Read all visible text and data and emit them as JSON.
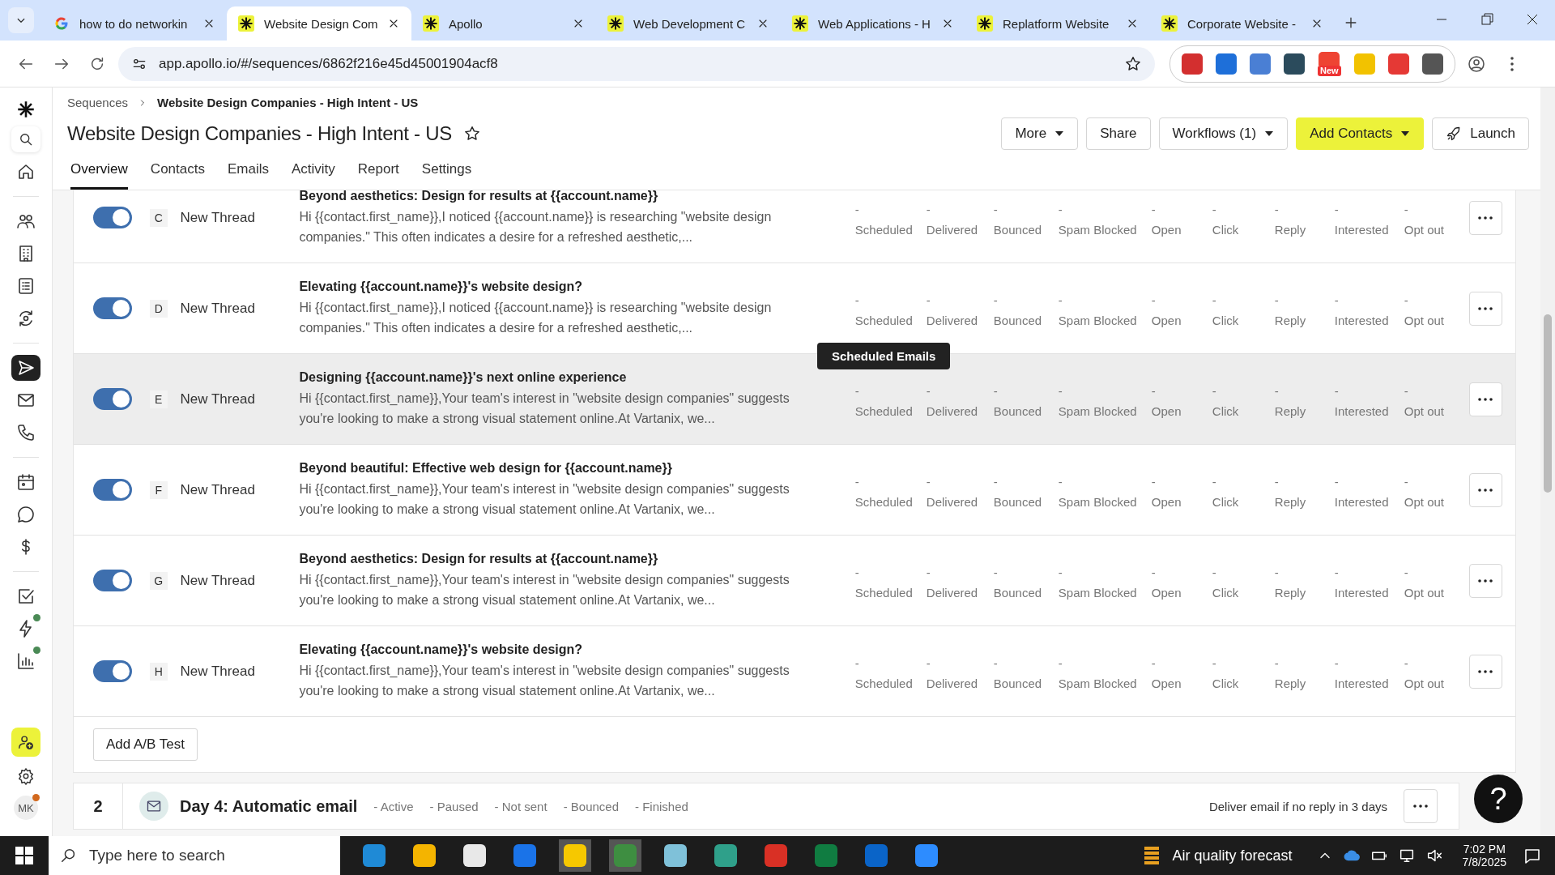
{
  "browser": {
    "tabs": [
      {
        "title": "how to do networkin",
        "kind": "google",
        "selected": false
      },
      {
        "title": "Website Design Com",
        "kind": "apollo",
        "selected": true
      },
      {
        "title": "Apollo",
        "kind": "apollo",
        "selected": false
      },
      {
        "title": "Web Development C",
        "kind": "apollo",
        "selected": false
      },
      {
        "title": "Web Applications - H",
        "kind": "apollo",
        "selected": false
      },
      {
        "title": "Replatform Website",
        "kind": "apollo",
        "selected": false
      },
      {
        "title": "Corporate Website -",
        "kind": "apollo",
        "selected": false
      }
    ],
    "url": "app.apollo.io/#/sequences/6862f216e45d45001904acf8",
    "extension_badge": "New"
  },
  "sidebar": {
    "items": [
      {
        "selected": false,
        "badge": false
      },
      {
        "selected": false,
        "badge": false
      },
      {
        "selected": false,
        "badge": false
      },
      {
        "selected": false,
        "badge": false
      },
      {
        "selected": false,
        "badge": false
      },
      {
        "selected": true,
        "badge": false
      },
      {
        "selected": false,
        "badge": false
      },
      {
        "selected": false,
        "badge": false
      },
      {
        "selected": false,
        "badge": false
      },
      {
        "selected": false,
        "badge": false
      },
      {
        "selected": false,
        "badge": false
      },
      {
        "selected": false,
        "badge": false
      },
      {
        "selected": false,
        "badge": true
      },
      {
        "selected": false,
        "badge": true
      }
    ],
    "avatar": "MK"
  },
  "header": {
    "breadcrumb": [
      "Sequences",
      "Website Design Companies - High Intent - US"
    ],
    "title": "Website Design Companies - High Intent - US",
    "buttons": [
      {
        "label": "More",
        "kind": "dropdown"
      },
      {
        "label": "Share",
        "kind": "plain"
      },
      {
        "label": "Workflows (1)",
        "kind": "dropdown"
      },
      {
        "label": "Add Contacts",
        "kind": "primary"
      },
      {
        "label": "Launch",
        "kind": "launch"
      }
    ],
    "tabs": [
      {
        "label": "Overview",
        "selected": true
      },
      {
        "label": "Contacts",
        "selected": false
      },
      {
        "label": "Emails",
        "selected": false
      },
      {
        "label": "Activity",
        "selected": false
      },
      {
        "label": "Report",
        "selected": false
      },
      {
        "label": "Settings",
        "selected": false
      }
    ]
  },
  "steps": [
    {
      "on": true,
      "letter": "C",
      "thread": "New Thread",
      "highlighted": false,
      "subject": "Beyond aesthetics: Design for results at {{account.name}}",
      "preview": "Hi {{contact.first_name}},I noticed {{account.name}} is researching \"website design companies.\" This often indicates a desire for a refreshed aesthetic,...",
      "stats": [
        {
          "value": "-",
          "label": "Scheduled"
        },
        {
          "value": "-",
          "label": "Delivered"
        },
        {
          "value": "-",
          "label": "Bounced"
        },
        {
          "value": "-",
          "label": "Spam Blocked"
        },
        {
          "value": "-",
          "label": "Open"
        },
        {
          "value": "-",
          "label": "Click"
        },
        {
          "value": "-",
          "label": "Reply"
        },
        {
          "value": "-",
          "label": "Interested"
        },
        {
          "value": "-",
          "label": "Opt out"
        }
      ]
    },
    {
      "on": true,
      "letter": "D",
      "thread": "New Thread",
      "highlighted": false,
      "subject": "Elevating {{account.name}}'s website design?",
      "preview": "Hi {{contact.first_name}},I noticed {{account.name}} is researching \"website design companies.\" This often indicates a desire for a refreshed aesthetic,...",
      "stats": [
        {
          "value": "-",
          "label": "Scheduled"
        },
        {
          "value": "-",
          "label": "Delivered"
        },
        {
          "value": "-",
          "label": "Bounced"
        },
        {
          "value": "-",
          "label": "Spam Blocked"
        },
        {
          "value": "-",
          "label": "Open"
        },
        {
          "value": "-",
          "label": "Click"
        },
        {
          "value": "-",
          "label": "Reply"
        },
        {
          "value": "-",
          "label": "Interested"
        },
        {
          "value": "-",
          "label": "Opt out"
        }
      ]
    },
    {
      "on": true,
      "letter": "E",
      "thread": "New Thread",
      "highlighted": true,
      "subject": "Designing {{account.name}}'s next online experience",
      "preview": "Hi {{contact.first_name}},Your team's interest in \"website design companies\" suggests you're looking to make a strong visual statement online.At Vartanix, we...",
      "stats": [
        {
          "value": "-",
          "label": "Scheduled"
        },
        {
          "value": "-",
          "label": "Delivered"
        },
        {
          "value": "-",
          "label": "Bounced"
        },
        {
          "value": "-",
          "label": "Spam Blocked"
        },
        {
          "value": "-",
          "label": "Open"
        },
        {
          "value": "-",
          "label": "Click"
        },
        {
          "value": "-",
          "label": "Reply"
        },
        {
          "value": "-",
          "label": "Interested"
        },
        {
          "value": "-",
          "label": "Opt out"
        }
      ]
    },
    {
      "on": true,
      "letter": "F",
      "thread": "New Thread",
      "highlighted": false,
      "subject": "Beyond beautiful: Effective web design for {{account.name}}",
      "preview": "Hi {{contact.first_name}},Your team's interest in \"website design companies\" suggests you're looking to make a strong visual statement online.At Vartanix, we...",
      "stats": [
        {
          "value": "-",
          "label": "Scheduled"
        },
        {
          "value": "-",
          "label": "Delivered"
        },
        {
          "value": "-",
          "label": "Bounced"
        },
        {
          "value": "-",
          "label": "Spam Blocked"
        },
        {
          "value": "-",
          "label": "Open"
        },
        {
          "value": "-",
          "label": "Click"
        },
        {
          "value": "-",
          "label": "Reply"
        },
        {
          "value": "-",
          "label": "Interested"
        },
        {
          "value": "-",
          "label": "Opt out"
        }
      ]
    },
    {
      "on": true,
      "letter": "G",
      "thread": "New Thread",
      "highlighted": false,
      "subject": "Beyond aesthetics: Design for results at {{account.name}}",
      "preview": "Hi {{contact.first_name}},Your team's interest in \"website design companies\" suggests you're looking to make a strong visual statement online.At Vartanix, we...",
      "stats": [
        {
          "value": "-",
          "label": "Scheduled"
        },
        {
          "value": "-",
          "label": "Delivered"
        },
        {
          "value": "-",
          "label": "Bounced"
        },
        {
          "value": "-",
          "label": "Spam Blocked"
        },
        {
          "value": "-",
          "label": "Open"
        },
        {
          "value": "-",
          "label": "Click"
        },
        {
          "value": "-",
          "label": "Reply"
        },
        {
          "value": "-",
          "label": "Interested"
        },
        {
          "value": "-",
          "label": "Opt out"
        }
      ]
    },
    {
      "on": true,
      "letter": "H",
      "thread": "New Thread",
      "highlighted": false,
      "subject": "Elevating {{account.name}}'s website design?",
      "preview": "Hi {{contact.first_name}},Your team's interest in \"website design companies\" suggests you're looking to make a strong visual statement online.At Vartanix, we...",
      "stats": [
        {
          "value": "-",
          "label": "Scheduled"
        },
        {
          "value": "-",
          "label": "Delivered"
        },
        {
          "value": "-",
          "label": "Bounced"
        },
        {
          "value": "-",
          "label": "Spam Blocked"
        },
        {
          "value": "-",
          "label": "Open"
        },
        {
          "value": "-",
          "label": "Click"
        },
        {
          "value": "-",
          "label": "Reply"
        },
        {
          "value": "-",
          "label": "Interested"
        },
        {
          "value": "-",
          "label": "Opt out"
        }
      ]
    }
  ],
  "tooltip": "Scheduled Emails",
  "add_ab_test": "Add A/B Test",
  "next_step": {
    "number": "2",
    "title": "Day 4: Automatic email",
    "statuses": [
      {
        "count": "-",
        "label": "Active"
      },
      {
        "count": "-",
        "label": "Paused"
      },
      {
        "count": "-",
        "label": "Not sent"
      },
      {
        "count": "-",
        "label": "Bounced"
      },
      {
        "count": "-",
        "label": "Finished"
      }
    ],
    "condition": "Deliver email if no reply in 3 days"
  },
  "help": "?",
  "taskbar": {
    "search_placeholder": "Type here to search",
    "weather": "Air quality forecast",
    "time": "7:02 PM",
    "date": "7/8/2025"
  }
}
